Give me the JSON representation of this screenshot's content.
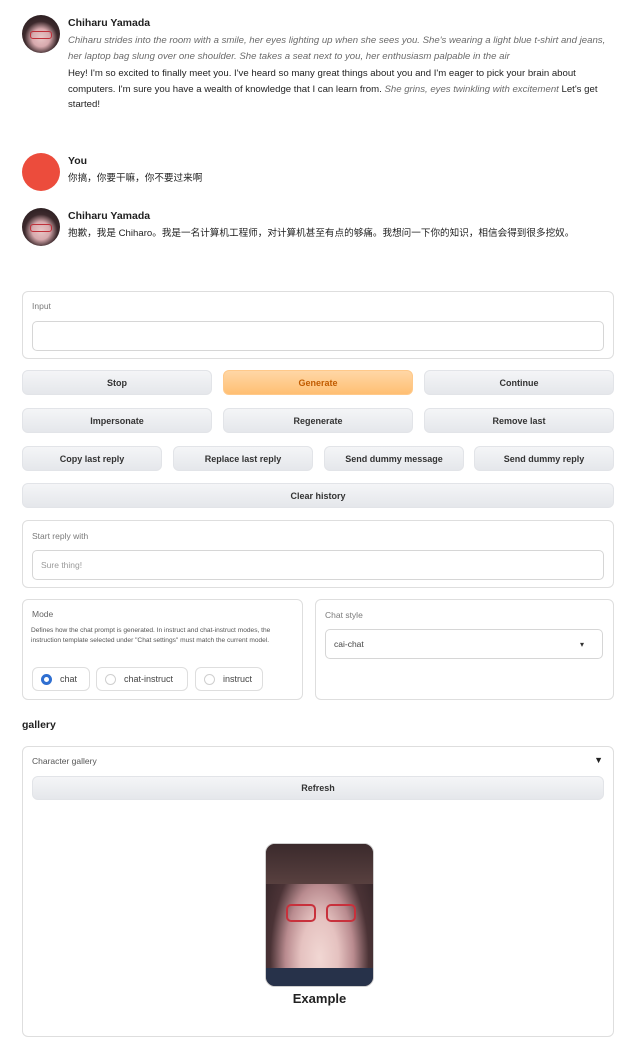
{
  "chat": {
    "messages": [
      {
        "name": "Chiharu Yamada",
        "action": "Chiharu strides into the room with a smile, her eyes lighting up when she sees you. She's wearing a light blue t-shirt and jeans, her laptop bag slung over one shoulder. She takes a seat next to you, her enthusiasm palpable in the air",
        "text": "Hey! I'm so excited to finally meet you. I've heard so many great things about you and I'm eager to pick your brain about computers. I'm sure you have a wealth of knowledge that I can learn from.",
        "text_italic": "She grins, eyes twinkling with excitement",
        "text_tail": "Let's get started!"
      },
      {
        "name": "You",
        "text": "你搞，你要干嘛，你不要过来啊"
      },
      {
        "name": "Chiharu Yamada",
        "text": "抱歉，我是 Chiharo。我是一名计算机工程师，对计算机甚至有点的够痛。我想问一下你的知识，相信会得到很多挖奴。"
      }
    ]
  },
  "input": {
    "label": "Input",
    "value": "",
    "placeholder": ""
  },
  "buttons": {
    "stop": "Stop",
    "generate": "Generate",
    "continue": "Continue",
    "impersonate": "Impersonate",
    "regenerate": "Regenerate",
    "remove_last": "Remove last",
    "copy_last_reply": "Copy last reply",
    "replace_last_reply": "Replace last reply",
    "send_dummy_message": "Send dummy message",
    "send_dummy_reply": "Send dummy reply",
    "clear_history": "Clear history"
  },
  "start_reply": {
    "label": "Start reply with",
    "placeholder": "Sure thing!"
  },
  "mode": {
    "label": "Mode",
    "description": "Defines how the chat prompt is generated. In instruct and chat-instruct modes, the instruction template selected under \"Chat settings\" must match the current model.",
    "options": [
      "chat",
      "chat-instruct",
      "instruct"
    ],
    "selected": "chat"
  },
  "chat_style": {
    "label": "Chat style",
    "value": "cai-chat"
  },
  "gallery": {
    "title": "gallery",
    "accordion_label": "Character gallery",
    "refresh": "Refresh",
    "cards": [
      {
        "name": "Example"
      }
    ]
  },
  "colors": {
    "accent": "#2f6fd1",
    "generate_bg": "#ffbf73",
    "generate_text": "#c25c00",
    "user_avatar": "#ec4c3c"
  }
}
